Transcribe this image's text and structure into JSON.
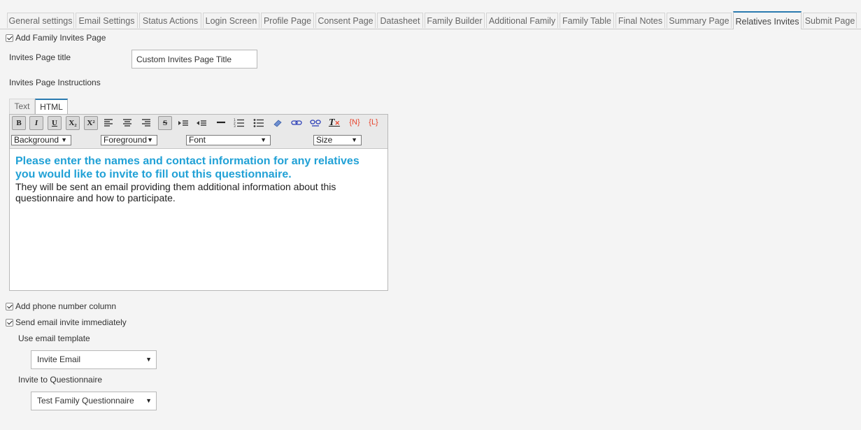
{
  "tabs": [
    {
      "label": "General settings"
    },
    {
      "label": "Email Settings"
    },
    {
      "label": "Status Actions"
    },
    {
      "label": "Login Screen"
    },
    {
      "label": "Profile Page"
    },
    {
      "label": "Consent Page"
    },
    {
      "label": "Datasheet"
    },
    {
      "label": "Family Builder"
    },
    {
      "label": "Additional Family"
    },
    {
      "label": "Family Table"
    },
    {
      "label": "Final Notes"
    },
    {
      "label": "Summary Page"
    },
    {
      "label": "Relatives Invites",
      "active": true
    },
    {
      "label": "Submit Page"
    }
  ],
  "form": {
    "add_invites_label": "Add Family Invites Page",
    "title_label": "Invites Page title",
    "title_value": "Custom Invites Page Title",
    "instructions_label": "Invites Page Instructions",
    "add_phone_label": "Add phone number column",
    "send_email_label": "Send email invite immediately",
    "template_label": "Use email template",
    "template_value": "Invite Email",
    "questionnaire_label": "Invite to Questionnaire",
    "questionnaire_value": "Test Family Questionnaire"
  },
  "editor": {
    "tabs": {
      "text": "Text",
      "html": "HTML"
    },
    "toolbar": {
      "bold": "B",
      "italic": "I",
      "underline": "U",
      "subscript": "X₂",
      "superscript": "X²",
      "strike": "S",
      "clear_format": "T",
      "insert_name": "{N}",
      "insert_link_token": "{L}",
      "background": "Background",
      "foreground": "Foreground",
      "font": "Font",
      "size": "Size"
    },
    "content": {
      "heading": "Please enter the names and contact information for any relatives you would like to invite to fill out this questionnaire.",
      "body": "They will be sent an email providing them additional information about this questionnaire and how to participate."
    }
  },
  "colors": {
    "accent": "#2a7ab0",
    "heading_text": "#21a1d6",
    "token_red": "#e8442d"
  }
}
